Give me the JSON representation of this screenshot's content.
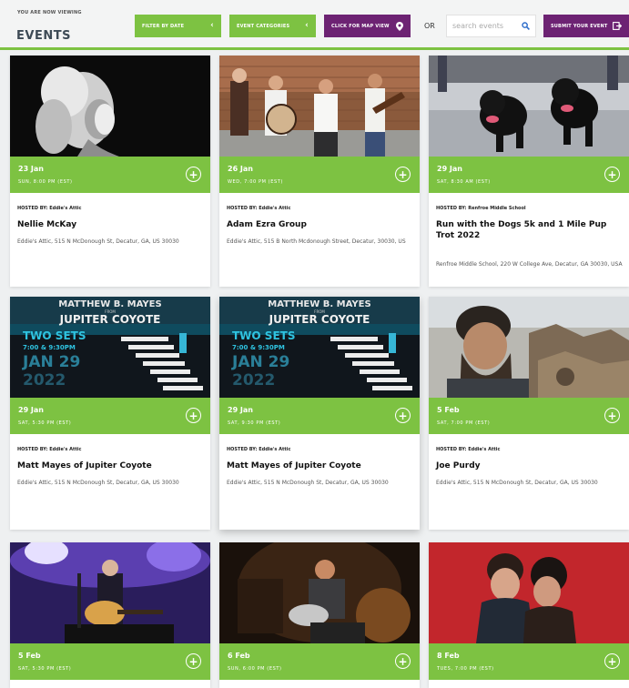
{
  "header": {
    "viewing_label": "YOU ARE NOW VIEWING",
    "title": "EVENTS",
    "filter_date_label": "FILTER BY DATE",
    "categories_label": "EVENT CATEGORIES",
    "map_view_label": "CLICK FOR MAP VIEW",
    "or_label": "OR",
    "search_placeholder": "search events",
    "submit_label": "SUBMIT YOUR EVENT"
  },
  "colors": {
    "accent_green": "#7dc242",
    "accent_purple": "#6d2373"
  },
  "events": [
    {
      "date": "23 Jan",
      "time": "SUN, 8:00 PM (EST)",
      "hosted": "HOSTED BY: Eddie's Attic",
      "name": "Nellie McKay",
      "address": "Eddie's Attic, 515 N McDonough St, Decatur, GA, US 30030",
      "image": "singer-portrait-bw"
    },
    {
      "date": "26 Jan",
      "time": "WED, 7:00 PM (EST)",
      "hosted": "HOSTED BY: Eddie's Attic",
      "name": "Adam Ezra Group",
      "address": "Eddie's Attic, 515 B North Mcdonough Street, Decatur, 30030, US",
      "image": "band-photo"
    },
    {
      "date": "29 Jan",
      "time": "SAT, 8:30 AM (EST)",
      "hosted": "HOSTED BY: Renfroe Middle School",
      "name": "Run with the Dogs 5k and 1 Mile Pup Trot 2022",
      "address": "Renfroe Middle School, 220 W College Ave, Decatur, GA 30030, USA",
      "image": "black-dogs-running"
    },
    {
      "date": "29 Jan",
      "time": "SAT, 5:30 PM (EST)",
      "hosted": "HOSTED BY: Eddie's Attic",
      "name": "Matt Mayes of Jupiter Coyote",
      "address": "Eddie's Attic, 515 N McDonough St, Decatur, GA, US 30030",
      "image": "jupiter-coyote-poster",
      "poster": {
        "line1": "MATTHEW B. MAYES",
        "line2": "FROM",
        "line3": "JUPITER COYOTE",
        "line4": "TWO SETS",
        "line5": "7:00 & 9:30PM",
        "line6": "JAN 29",
        "line7": "2022"
      }
    },
    {
      "date": "29 Jan",
      "time": "SAT, 9:30 PM (EST)",
      "hosted": "HOSTED BY: Eddie's Attic",
      "name": "Matt Mayes of Jupiter Coyote",
      "address": "Eddie's Attic, 515 N McDonough St, Decatur, GA, US 30030",
      "image": "jupiter-coyote-poster",
      "poster": {
        "line1": "MATTHEW B. MAYES",
        "line2": "FROM",
        "line3": "JUPITER COYOTE",
        "line4": "TWO SETS",
        "line5": "7:00 & 9:30PM",
        "line6": "JAN 29",
        "line7": "2022"
      }
    },
    {
      "date": "5 Feb",
      "time": "SAT, 7:00 PM (EST)",
      "hosted": "HOSTED BY: Eddie's Attic",
      "name": "Joe Purdy",
      "address": "Eddie's Attic, 515 N McDonough St, Decatur, GA, US 30030",
      "image": "bearded-man-desert"
    },
    {
      "date": "5 Feb",
      "time": "SAT, 5:30 PM (EST)",
      "image": "guitarist-on-stage"
    },
    {
      "date": "6 Feb",
      "time": "SUN, 6:00 PM (EST)",
      "image": "slide-guitar-player"
    },
    {
      "date": "8 Feb",
      "time": "TUES, 7:00 PM (EST)",
      "image": "duo-red-background"
    }
  ]
}
